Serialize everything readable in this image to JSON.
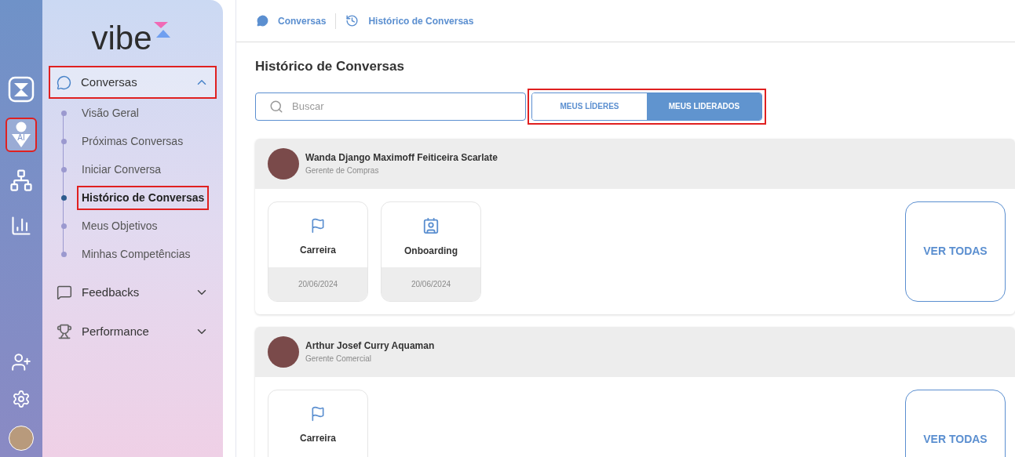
{
  "rail": {
    "items": [
      {
        "kind": "logo",
        "highlighted": false
      },
      {
        "kind": "ai",
        "highlighted": true,
        "badge": "AI"
      },
      {
        "kind": "network",
        "highlighted": false
      },
      {
        "kind": "chart",
        "highlighted": false
      }
    ],
    "bottom": [
      {
        "kind": "add-user"
      },
      {
        "kind": "settings"
      },
      {
        "kind": "avatar"
      }
    ]
  },
  "sidebar": {
    "logo": "vibe",
    "sections": [
      {
        "label": "Conversas",
        "expanded": true,
        "highlighted": true,
        "children": [
          {
            "label": "Visão Geral",
            "selected": false,
            "highlighted": false
          },
          {
            "label": "Próximas Conversas",
            "selected": false,
            "highlighted": false
          },
          {
            "label": "Iniciar Conversa",
            "selected": false,
            "highlighted": false
          },
          {
            "label": "Histórico de Conversas",
            "selected": true,
            "highlighted": true
          },
          {
            "label": "Meus Objetivos",
            "selected": false,
            "highlighted": false
          },
          {
            "label": "Minhas Competências",
            "selected": false,
            "highlighted": false
          }
        ]
      },
      {
        "label": "Feedbacks",
        "expanded": false,
        "highlighted": false
      },
      {
        "label": "Performance",
        "expanded": false,
        "highlighted": false
      }
    ]
  },
  "breadcrumb": [
    {
      "label": "Conversas"
    },
    {
      "label": "Histórico de Conversas"
    }
  ],
  "page_title": "Histórico de Conversas",
  "search": {
    "placeholder": "Buscar"
  },
  "toggle": {
    "highlighted": true,
    "options": [
      {
        "label": "MEUS LÍDERES",
        "selected": false
      },
      {
        "label": "MEUS LIDERADOS",
        "selected": true
      }
    ]
  },
  "people": [
    {
      "name": "Wanda Django Maximoff Feiticeira Scarlate",
      "role": "Gerente de Compras",
      "conversations": [
        {
          "label": "Carreira",
          "kind": "career",
          "date": "20/06/2024"
        },
        {
          "label": "Onboarding",
          "kind": "onboarding",
          "date": "20/06/2024"
        }
      ],
      "see_all": "VER TODAS"
    },
    {
      "name": "Arthur Josef Curry Aquaman",
      "role": "Gerente Comercial",
      "conversations": [
        {
          "label": "Carreira",
          "kind": "career"
        }
      ],
      "see_all": "VER TODAS"
    }
  ]
}
